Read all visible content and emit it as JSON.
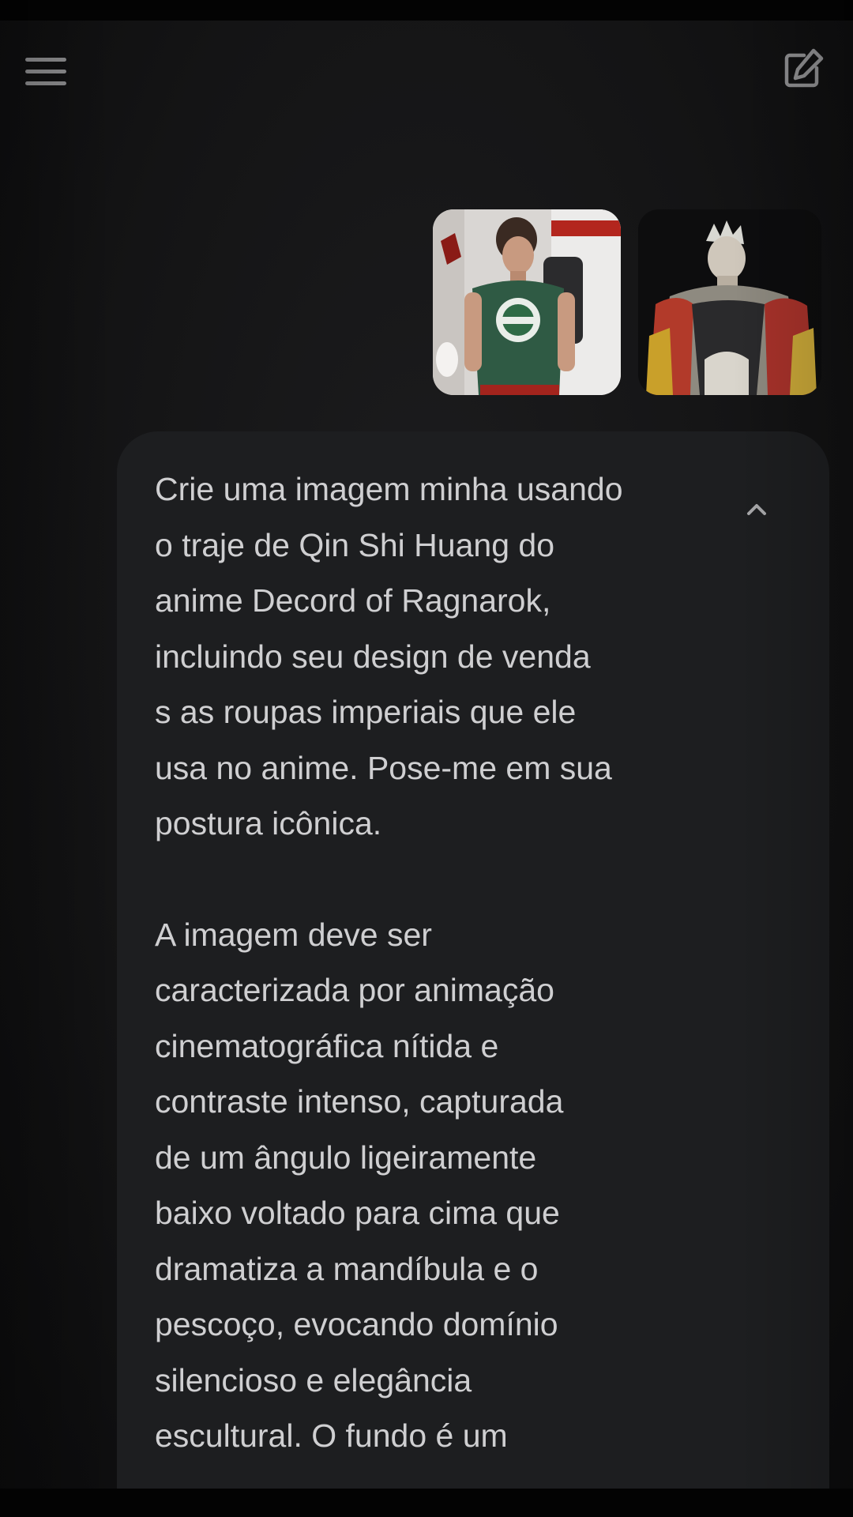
{
  "header": {
    "menu_icon": "hamburger-menu-icon",
    "new_chat_icon": "edit-square-icon"
  },
  "attachments": [
    {
      "icon": "photo-man-green-tshirt"
    },
    {
      "icon": "photo-anime-character-qin-shi-huang"
    }
  ],
  "message": {
    "collapse_icon": "chevron-up-icon",
    "paragraphs": [
      {
        "lines": [
          "Crie uma imagem minha usando",
          "o traje de Qin Shi Huang do",
          "anime Decord of Ragnarok,",
          "incluindo seu design de venda",
          "s as roupas imperiais que ele",
          "usa no anime. Pose-me em sua",
          "postura icônica."
        ]
      },
      {
        "lines": [
          "A imagem deve ser",
          "caracterizada por animação",
          "cinematográfica nítida e",
          "contraste intenso, capturada",
          "de um ângulo ligeiramente",
          "baixo voltado para cima que",
          "dramatiza a mandíbula e o",
          "pescoço, evocando domínio",
          "silencioso e elegância",
          "escultural. O fundo é um"
        ]
      }
    ]
  },
  "colors": {
    "background": "#141415",
    "bubble": "#1d1e20",
    "text": "#cfcfd1",
    "icon": "#8e8e90"
  }
}
